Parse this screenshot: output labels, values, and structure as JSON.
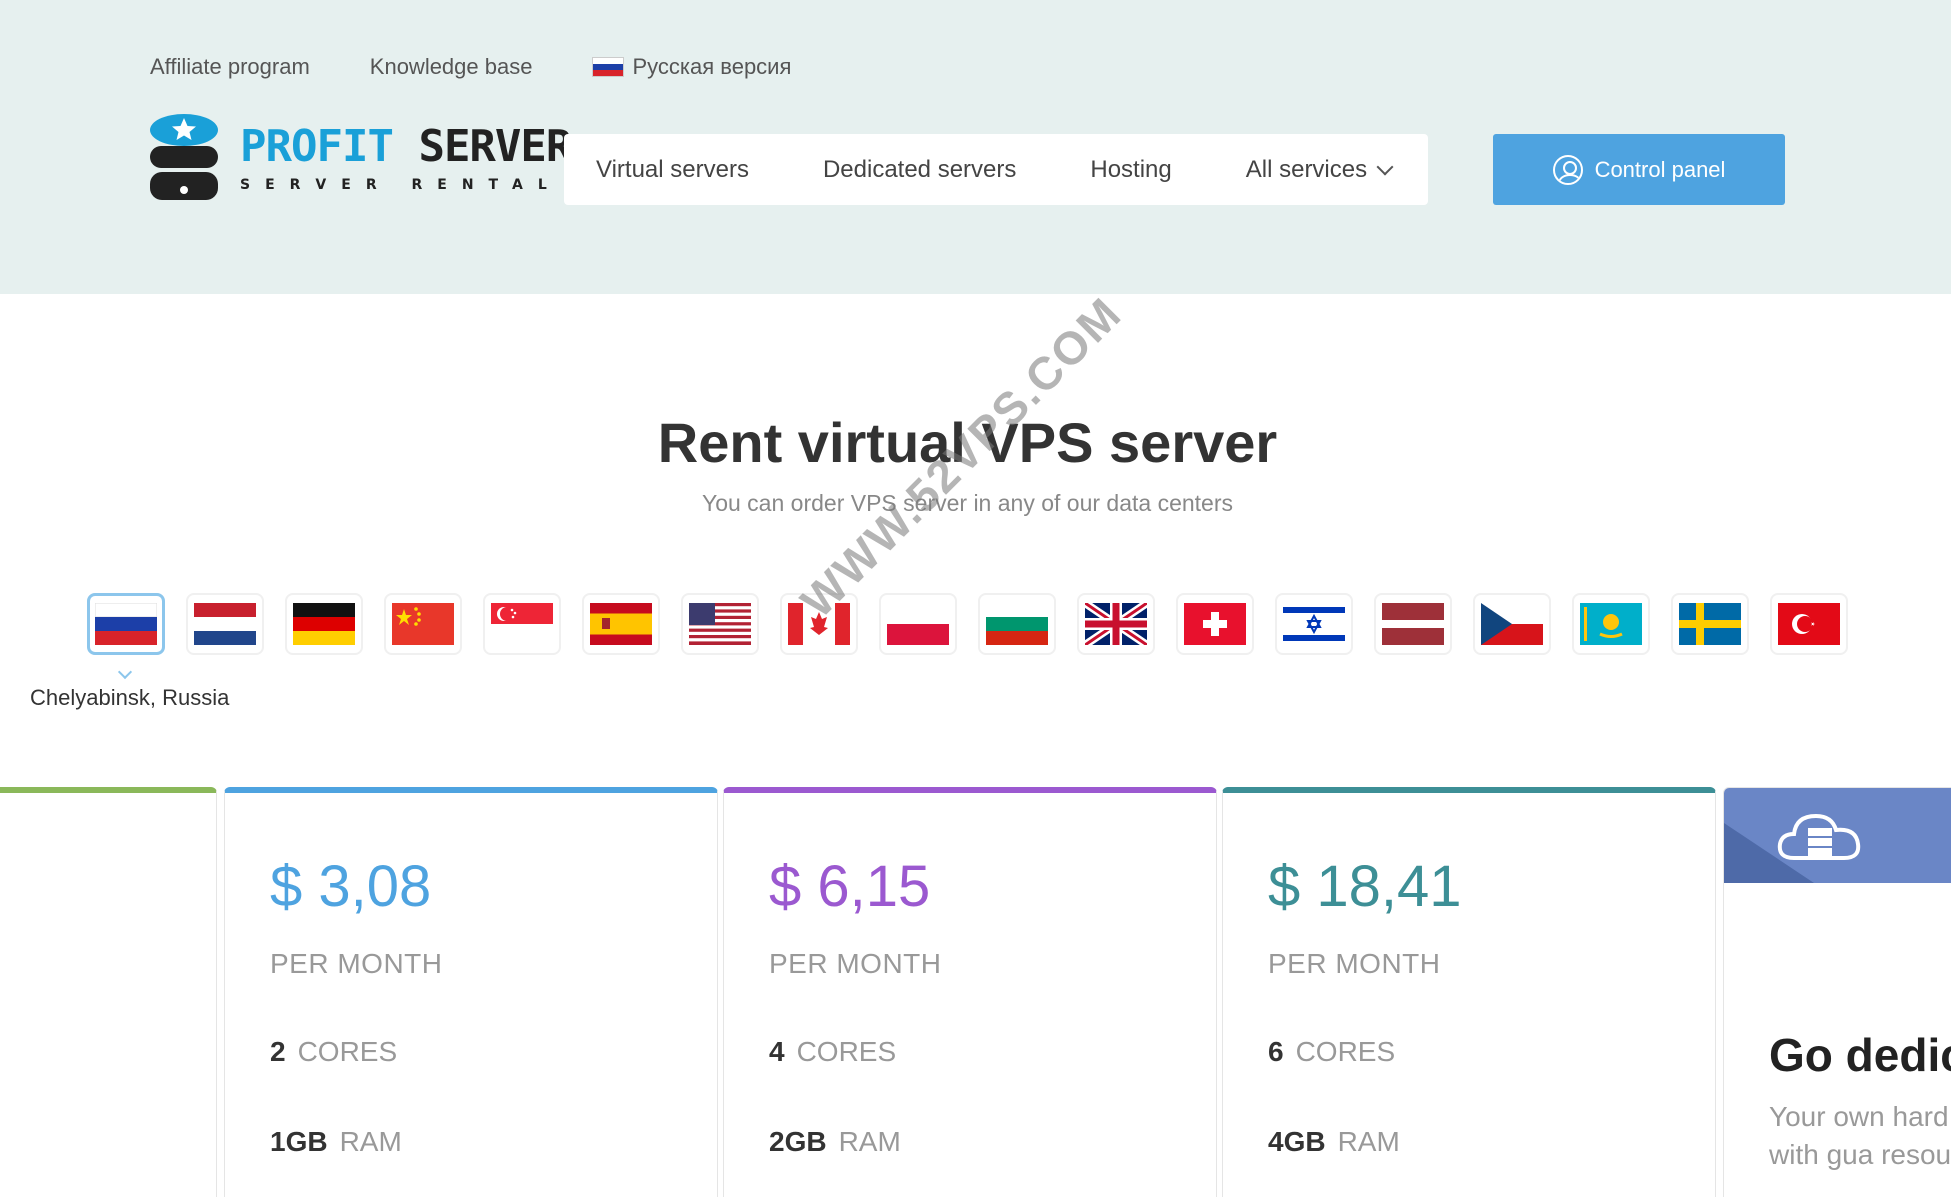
{
  "header": {
    "top_links": [
      "Affiliate program",
      "Knowledge base"
    ],
    "lang_link": "Русская версия",
    "logo": {
      "brand_part1": "PROFIT",
      "brand_part2": "SERVER",
      "tagline": "SERVER RENTAL"
    },
    "nav": [
      "Virtual servers",
      "Dedicated servers",
      "Hosting",
      "All services"
    ],
    "control_panel": "Control panel"
  },
  "hero": {
    "title": "Rent virtual VPS server",
    "subtitle": "You can order VPS server in any of our data centers"
  },
  "datacenters": {
    "selected_label": "Chelyabinsk, Russia",
    "flags": [
      "russia-flag",
      "netherlands-flag",
      "germany-flag",
      "china-flag",
      "singapore-flag",
      "spain-flag",
      "usa-flag",
      "canada-flag",
      "poland-flag",
      "bulgaria-flag",
      "uk-flag",
      "switzerland-flag",
      "israel-flag",
      "latvia-flag",
      "czech-flag",
      "kazakhstan-flag",
      "sweden-flag",
      "turkey-flag"
    ]
  },
  "watermark": "WWW.52VPS.COM",
  "plans": [
    {
      "price": "$ 3,08",
      "period": "PER MONTH",
      "cores_value": "2",
      "cores_unit": "CORES",
      "ram_value": "1GB",
      "ram_unit": "RAM",
      "color": "#4ea3e0"
    },
    {
      "price": "$ 6,15",
      "period": "PER MONTH",
      "cores_value": "4",
      "cores_unit": "CORES",
      "ram_value": "2GB",
      "ram_unit": "RAM",
      "color": "#9b59d0"
    },
    {
      "price": "$ 18,41",
      "period": "PER MONTH",
      "cores_value": "6",
      "cores_unit": "CORES",
      "ram_value": "4GB",
      "ram_unit": "RAM",
      "color": "#3d8f96"
    }
  ],
  "dedicated": {
    "title": "Go dedic",
    "text": "Your own hard server with gua resources"
  },
  "colors": {
    "header_bg": "#e6f0ef",
    "button": "#4ea3e0",
    "card_left": "#8ab85a",
    "dedicated": "#6a86c6"
  }
}
